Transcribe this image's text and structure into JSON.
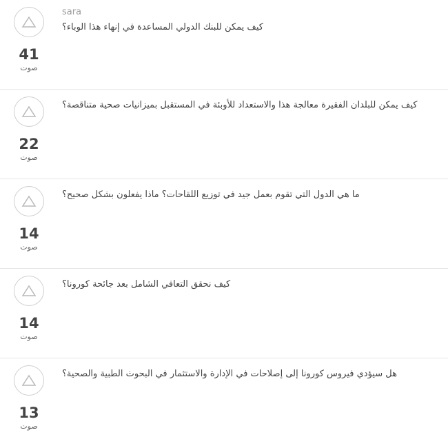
{
  "questions": [
    {
      "author": "sara",
      "title": "كيف يمكن للبنك الدولي المساعدة في إنهاء هذا الوباء؟",
      "votes": "41",
      "votes_label": "صوت"
    },
    {
      "author": "",
      "title": "كيف يمكن للبلدان الفقيرة معالجة هذا والاستعداد للأوبئة في المستقبل بميزانيات صحية متناقصة؟",
      "votes": "22",
      "votes_label": "صوت"
    },
    {
      "author": "",
      "title": "ما هي الدول التي تقوم بعمل جيد في توزيع اللقاحات؟ ماذا يفعلون بشكل صحيح؟",
      "votes": "14",
      "votes_label": "صوت"
    },
    {
      "author": "",
      "title": "كيف نحقق التعافي الشامل بعد جائحة كورونا؟",
      "votes": "14",
      "votes_label": "صوت"
    },
    {
      "author": "",
      "title": "هل سيؤدي فيروس كورونا إلى إصلاحات في الإدارة والاستثمار في البحوث الطبية والصحية؟",
      "votes": "13",
      "votes_label": "صوت"
    }
  ],
  "icons": {
    "upvote": "triangle-up-icon"
  },
  "colors": {
    "text": "#444444",
    "muted": "#999999",
    "border": "#cfcfcf"
  }
}
